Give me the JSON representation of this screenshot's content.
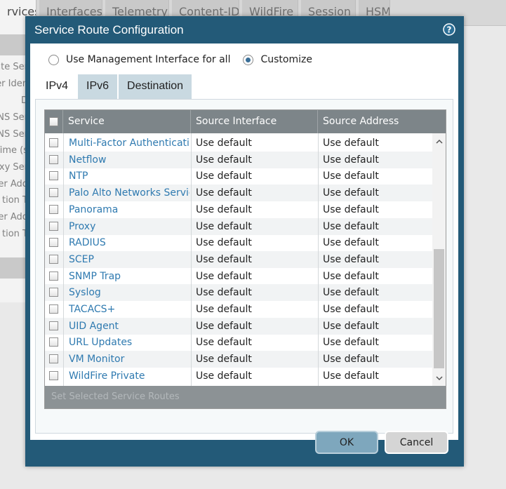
{
  "background": {
    "tabs": [
      "rvices",
      "Interfaces",
      "Telemetry",
      "Content-ID",
      "WildFire",
      "Session",
      "HSM"
    ],
    "fragments": [
      "ate Ser",
      "er Iden",
      "D",
      "NS Ser",
      "NS Ser",
      "Time (s",
      "xy Ser",
      "er Add",
      "tion T",
      "er Add",
      "tion T"
    ]
  },
  "dialog": {
    "title": "Service Route Configuration",
    "help_icon": "help-icon",
    "radios": [
      {
        "label": "Use Management Interface for all",
        "checked": false
      },
      {
        "label": "Customize",
        "checked": true
      }
    ],
    "tabs": [
      {
        "label": "IPv4",
        "active": true
      },
      {
        "label": "IPv6",
        "active": false
      },
      {
        "label": "Destination",
        "active": false
      }
    ],
    "table": {
      "columns": [
        "Service",
        "Source Interface",
        "Source Address"
      ],
      "rows": [
        {
          "service": "Multi-Factor Authentication",
          "source_interface": "Use default",
          "source_address": "Use default"
        },
        {
          "service": "Netflow",
          "source_interface": "Use default",
          "source_address": "Use default"
        },
        {
          "service": "NTP",
          "source_interface": "Use default",
          "source_address": "Use default"
        },
        {
          "service": "Palo Alto Networks Services",
          "source_interface": "Use default",
          "source_address": "Use default"
        },
        {
          "service": "Panorama",
          "source_interface": "Use default",
          "source_address": "Use default"
        },
        {
          "service": "Proxy",
          "source_interface": "Use default",
          "source_address": "Use default"
        },
        {
          "service": "RADIUS",
          "source_interface": "Use default",
          "source_address": "Use default"
        },
        {
          "service": "SCEP",
          "source_interface": "Use default",
          "source_address": "Use default"
        },
        {
          "service": "SNMP Trap",
          "source_interface": "Use default",
          "source_address": "Use default"
        },
        {
          "service": "Syslog",
          "source_interface": "Use default",
          "source_address": "Use default"
        },
        {
          "service": "TACACS+",
          "source_interface": "Use default",
          "source_address": "Use default"
        },
        {
          "service": "UID Agent",
          "source_interface": "Use default",
          "source_address": "Use default"
        },
        {
          "service": "URL Updates",
          "source_interface": "Use default",
          "source_address": "Use default"
        },
        {
          "service": "VM Monitor",
          "source_interface": "Use default",
          "source_address": "Use default"
        },
        {
          "service": "WildFire Private",
          "source_interface": "Use default",
          "source_address": "Use default"
        }
      ],
      "footer_action": "Set Selected Service Routes"
    },
    "buttons": {
      "ok": "OK",
      "cancel": "Cancel"
    },
    "colors": {
      "title_bar": "#235a78",
      "link": "#2f7ab0",
      "header": "#7d8589",
      "ok_button": "#7ea7bd"
    }
  }
}
